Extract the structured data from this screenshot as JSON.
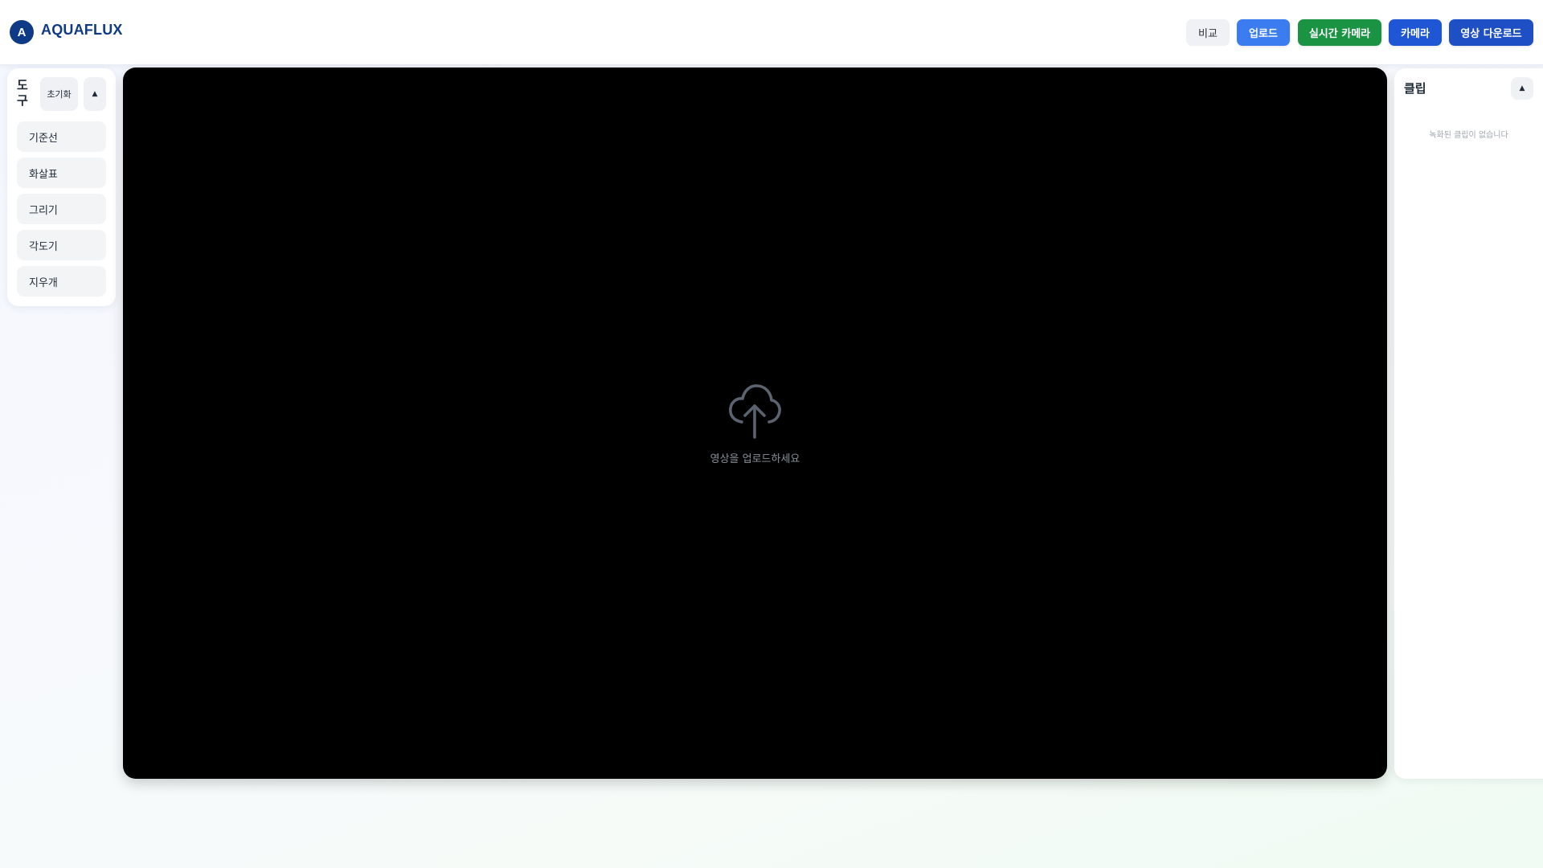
{
  "header": {
    "logo_letter": "A",
    "app_name": "AQUAFLUX",
    "buttons": {
      "compare": "비교",
      "upload": "업로드",
      "live_camera": "실시간 카메라",
      "camera": "카메라",
      "download": "영상 다운로드"
    },
    "colors": {
      "brand": "#0f3a85",
      "upload": "#3b7df0",
      "live_camera": "#1a9442",
      "camera": "#1f56d6",
      "download": "#1f4fc4"
    }
  },
  "tools": {
    "title": "도구",
    "reset_label": "초기화",
    "collapse_icon": "▲",
    "items": [
      {
        "label": "기준선"
      },
      {
        "label": "화살표"
      },
      {
        "label": "그리기"
      },
      {
        "label": "각도기"
      },
      {
        "label": "지우개"
      }
    ]
  },
  "player": {
    "icon": "upload-cloud-icon",
    "hint": "영상을 업로드하세요"
  },
  "clips": {
    "title": "클립",
    "collapse_icon": "▲",
    "empty_text": "녹화된 클립이 없습니다"
  }
}
